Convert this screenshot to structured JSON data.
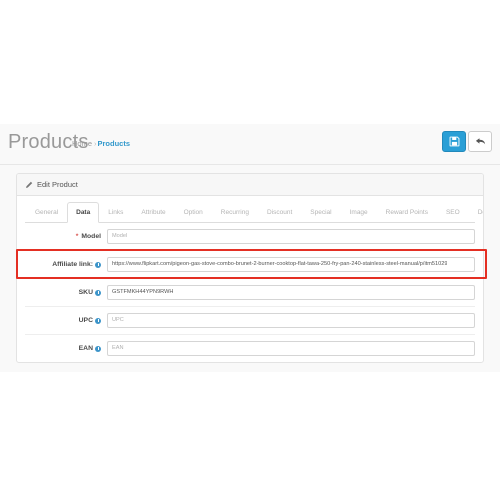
{
  "header": {
    "title": "Products",
    "breadcrumb": [
      {
        "label": "Home",
        "active": false
      },
      {
        "label": "Products",
        "active": true
      }
    ],
    "separator": "›",
    "buttons": [
      {
        "name": "save-button",
        "icon": "save-icon",
        "style": "primary"
      },
      {
        "name": "back-button",
        "icon": "back-arrow-icon",
        "style": "default"
      }
    ],
    "accent_color": "#2a9fd6",
    "breadcrumb_link_color": "#3399cc"
  },
  "panel": {
    "icon": "pencil-icon",
    "title": "Edit Product"
  },
  "tabs": [
    {
      "label": "General",
      "active": false
    },
    {
      "label": "Data",
      "active": true
    },
    {
      "label": "Links",
      "active": false
    },
    {
      "label": "Attribute",
      "active": false
    },
    {
      "label": "Option",
      "active": false
    },
    {
      "label": "Recurring",
      "active": false
    },
    {
      "label": "Discount",
      "active": false
    },
    {
      "label": "Special",
      "active": false
    },
    {
      "label": "Image",
      "active": false
    },
    {
      "label": "Reward Points",
      "active": false
    },
    {
      "label": "SEO",
      "active": false
    },
    {
      "label": "Design",
      "active": false
    }
  ],
  "form": {
    "fields": [
      {
        "label": "Model",
        "required": true,
        "info": false,
        "value": "",
        "placeholder": "Model",
        "name": "model-field"
      },
      {
        "label": "Affiliate link:",
        "required": false,
        "info": true,
        "value": "https://www.flipkart.com/pigeon-gas-stove-combo-brunet-2-burner-cooktop-flat-tawa-250-fry-pan-240-stainless-steel-manual/p/itm51029",
        "placeholder": "Affiliate link",
        "name": "affiliate-link-field",
        "highlighted": true
      },
      {
        "label": "SKU",
        "required": false,
        "info": true,
        "value": "GSTFMKH44YPN9RWH",
        "placeholder": "SKU",
        "name": "sku-field"
      },
      {
        "label": "UPC",
        "required": false,
        "info": true,
        "value": "",
        "placeholder": "UPC",
        "name": "upc-field"
      },
      {
        "label": "EAN",
        "required": false,
        "info": true,
        "value": "",
        "placeholder": "EAN",
        "name": "ean-field"
      }
    ]
  },
  "annotation": {
    "highlight_color": "#e42f23"
  }
}
